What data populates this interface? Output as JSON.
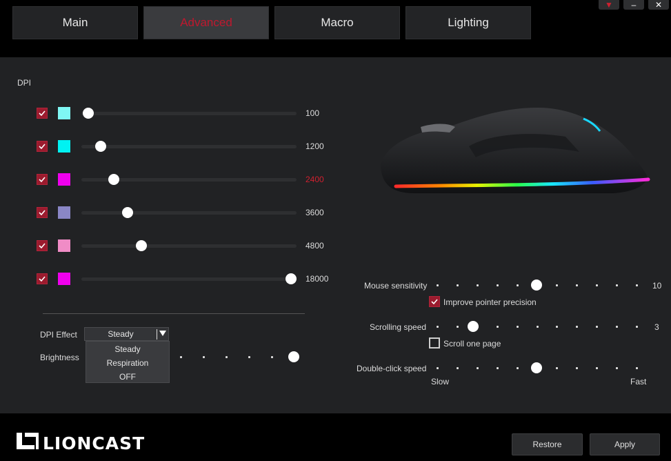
{
  "tabs": [
    {
      "label": "Main"
    },
    {
      "label": "Advanced"
    },
    {
      "label": "Macro"
    },
    {
      "label": "Lighting"
    }
  ],
  "window_controls": {
    "menu": "▼",
    "minimize": "–",
    "close": "✕"
  },
  "dpi": {
    "label": "DPI",
    "max": 18000,
    "levels": [
      {
        "value": "100",
        "color": "#7ff7f4",
        "checked": true
      },
      {
        "value": "1200",
        "color": "#00f2f2",
        "checked": true
      },
      {
        "value": "2400",
        "color": "#f000ee",
        "checked": true,
        "active": true
      },
      {
        "value": "3600",
        "color": "#8a87c6",
        "checked": true
      },
      {
        "value": "4800",
        "color": "#f08cc6",
        "checked": true
      },
      {
        "value": "18000",
        "color": "#f000ee",
        "checked": true
      }
    ]
  },
  "dpi_effect": {
    "label": "DPI Effect",
    "selected": "Steady",
    "options": [
      "Steady",
      "Respiration",
      "OFF"
    ]
  },
  "brightness": {
    "label": "Brightness"
  },
  "mouse_sensitivity": {
    "label": "Mouse sensitivity",
    "value": "10",
    "position": 0.5
  },
  "improve_precision": {
    "label": "Improve pointer precision",
    "checked": true
  },
  "scrolling_speed": {
    "label": "Scrolling speed",
    "value": "3",
    "position": 0.2
  },
  "scroll_one_page": {
    "label": "Scroll one page",
    "checked": false
  },
  "double_click_speed": {
    "label": "Double-click speed",
    "slow": "Slow",
    "fast": "Fast",
    "position": 0.5
  },
  "footer": {
    "brand": "LIONCAST",
    "restore": "Restore",
    "apply": "Apply"
  }
}
